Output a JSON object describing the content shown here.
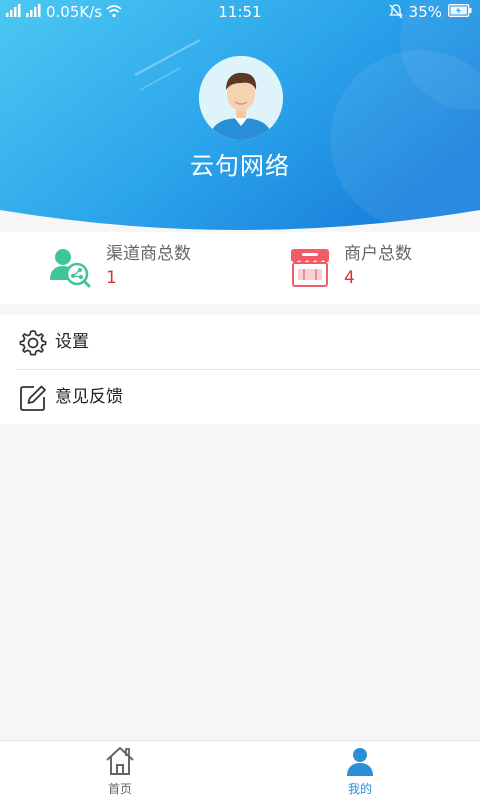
{
  "status_bar": {
    "signal_text": "0.05K/s",
    "time": "11:51",
    "battery_percent": "35%"
  },
  "profile": {
    "name": "云句网络"
  },
  "stats": [
    {
      "label": "渠道商总数",
      "value": "1",
      "icon": "distributor-icon"
    },
    {
      "label": "商户总数",
      "value": "4",
      "icon": "store-icon"
    }
  ],
  "menu": [
    {
      "label": "设置",
      "icon": "gear-icon"
    },
    {
      "label": "意见反馈",
      "icon": "edit-icon"
    }
  ],
  "bottom_nav": [
    {
      "label": "首页",
      "icon": "home-icon",
      "active": false
    },
    {
      "label": "我的",
      "icon": "person-icon",
      "active": true
    }
  ],
  "colors": {
    "header_gradient_start": "#45c5f0",
    "header_gradient_end": "#1a86e0",
    "accent": "#2a8fd6",
    "stat_value": "#d9343b"
  }
}
